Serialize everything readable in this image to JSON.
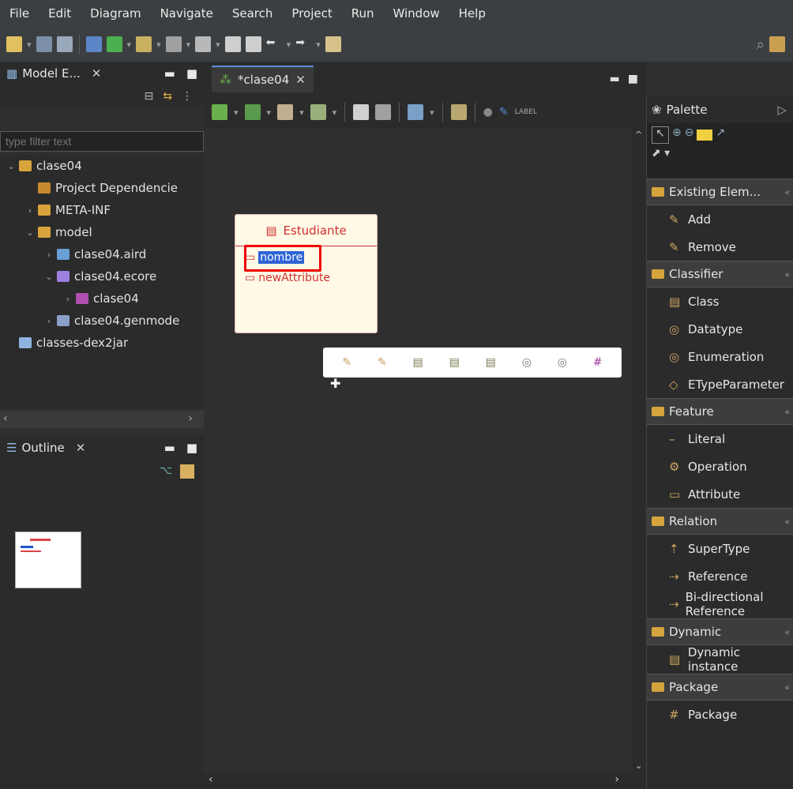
{
  "menu": [
    "File",
    "Edit",
    "Diagram",
    "Navigate",
    "Search",
    "Project",
    "Run",
    "Window",
    "Help"
  ],
  "model_explorer": {
    "tab": "Model E...",
    "filter_placeholder": "type filter text",
    "tree": [
      {
        "label": "clase04",
        "depth": 0,
        "tw": "⌄",
        "icon": "#d9a43b"
      },
      {
        "label": "Project Dependencie",
        "depth": 1,
        "tw": "",
        "icon": "#c98a2d"
      },
      {
        "label": "META-INF",
        "depth": 1,
        "tw": "›",
        "icon": "#d9a43b"
      },
      {
        "label": "model",
        "depth": 1,
        "tw": "⌄",
        "icon": "#d9a43b"
      },
      {
        "label": "clase04.aird",
        "depth": 2,
        "tw": "›",
        "icon": "#6aa0d8"
      },
      {
        "label": "clase04.ecore",
        "depth": 2,
        "tw": "⌄",
        "icon": "#9c7fe0"
      },
      {
        "label": "clase04",
        "depth": 3,
        "tw": "›",
        "icon": "#b04fb0"
      },
      {
        "label": "clase04.genmode",
        "depth": 2,
        "tw": "›",
        "icon": "#8aa0c8"
      },
      {
        "label": "classes-dex2jar",
        "depth": 0,
        "tw": "",
        "icon": "#8fb4e0"
      }
    ]
  },
  "outline": {
    "tab": "Outline"
  },
  "editor": {
    "tab": "*clase04",
    "class_name": "Estudiante",
    "attributes": [
      "nombre",
      "newAttribute"
    ]
  },
  "palette": {
    "title": "Palette",
    "drawers": [
      {
        "name": "Existing Elem...",
        "items": [
          "Add",
          "Remove"
        ]
      },
      {
        "name": "Classifier",
        "items": [
          "Class",
          "Datatype",
          "Enumeration",
          "ETypeParameter"
        ]
      },
      {
        "name": "Feature",
        "items": [
          "Literal",
          "Operation",
          "Attribute"
        ]
      },
      {
        "name": "Relation",
        "items": [
          "SuperType",
          "Reference",
          "Bi-directional Reference"
        ]
      },
      {
        "name": "Dynamic",
        "items": [
          "Dynamic instance"
        ]
      },
      {
        "name": "Package",
        "items": [
          "Package"
        ]
      }
    ]
  }
}
